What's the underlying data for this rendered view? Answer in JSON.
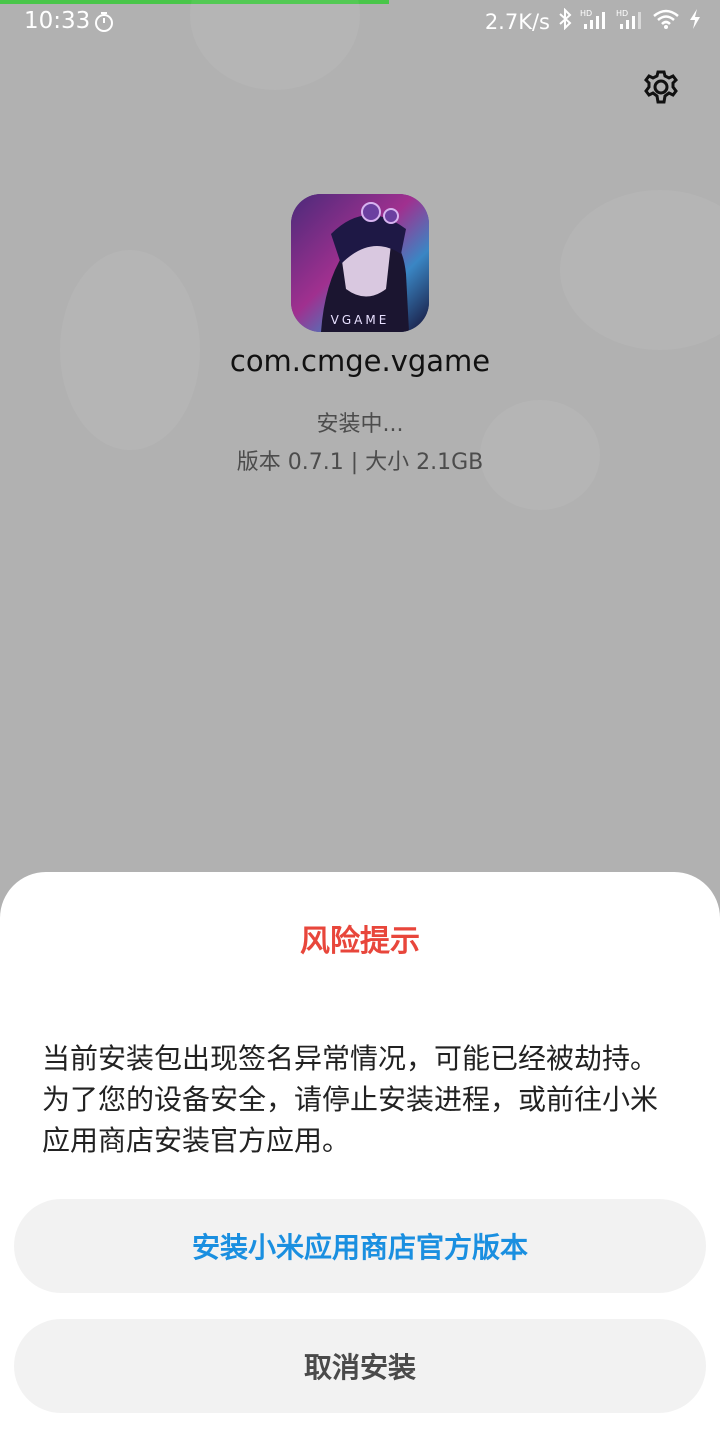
{
  "status_bar": {
    "time": "10:33",
    "net_speed": "2.7K/s",
    "icons": [
      "timer-icon",
      "bluetooth-icon",
      "signal-hd-icon",
      "signal-hd-icon",
      "wifi-icon",
      "charging-icon"
    ]
  },
  "install_progress_fraction": 0.54,
  "settings_icon": "gear-icon",
  "app": {
    "icon_text": "VGAME",
    "package_name": "com.cmge.vgame",
    "status": "安装中...",
    "version_info": "版本 0.7.1 | 大小 2.1GB"
  },
  "dialog": {
    "title": "风险提示",
    "message": "当前安装包出现签名异常情况，可能已经被劫持。为了您的设备安全，请停止安装进程，或前往小米应用商店安装官方应用。",
    "primary_button": "安装小米应用商店官方版本",
    "cancel_button": "取消安装"
  },
  "colors": {
    "title_red": "#e8463b",
    "primary_blue": "#1a8fe0",
    "progress_green": "#49c64a"
  }
}
